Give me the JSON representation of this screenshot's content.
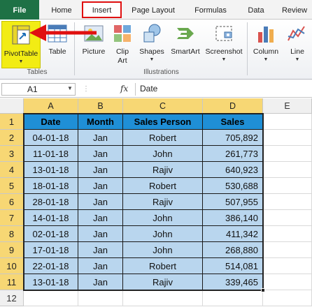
{
  "tabs": [
    "File",
    "Home",
    "Insert",
    "Page Layout",
    "Formulas",
    "Data",
    "Review"
  ],
  "ribbon": {
    "pivottable": "PivotTable",
    "table": "Table",
    "picture": "Picture",
    "clipart_line1": "Clip",
    "clipart_line2": "Art",
    "shapes": "Shapes",
    "smartart": "SmartArt",
    "screenshot": "Screenshot",
    "column": "Column",
    "line": "Line",
    "group_tables": "Tables",
    "group_illustrations": "Illustrations"
  },
  "formula_bar": {
    "name_box": "A1",
    "fx": "fx",
    "value": "Date"
  },
  "grid": {
    "columns": [
      "A",
      "B",
      "C",
      "D",
      "E"
    ],
    "rows": [
      "1",
      "2",
      "3",
      "4",
      "5",
      "6",
      "7",
      "8",
      "9",
      "10",
      "11",
      "12"
    ],
    "header": [
      "Date",
      "Month",
      "Sales Person",
      "Sales"
    ],
    "data": [
      [
        "04-01-18",
        "Jan",
        "Robert",
        "705,892"
      ],
      [
        "11-01-18",
        "Jan",
        "John",
        "261,773"
      ],
      [
        "13-01-18",
        "Jan",
        "Rajiv",
        "640,923"
      ],
      [
        "18-01-18",
        "Jan",
        "Robert",
        "530,688"
      ],
      [
        "28-01-18",
        "Jan",
        "Rajiv",
        "507,955"
      ],
      [
        "14-01-18",
        "Jan",
        "John",
        "386,140"
      ],
      [
        "02-01-18",
        "Jan",
        "John",
        "411,342"
      ],
      [
        "17-01-18",
        "Jan",
        "John",
        "268,880"
      ],
      [
        "22-01-18",
        "Jan",
        "Robert",
        "514,081"
      ],
      [
        "13-01-18",
        "Jan",
        "Rajiv",
        "339,465"
      ]
    ]
  },
  "colors": {
    "header_fill": "#1f8fd6",
    "data_fill": "#b9d6ee",
    "highlight": "#f2ec14",
    "arrow": "#e01010",
    "file_tab": "#1e7145"
  }
}
